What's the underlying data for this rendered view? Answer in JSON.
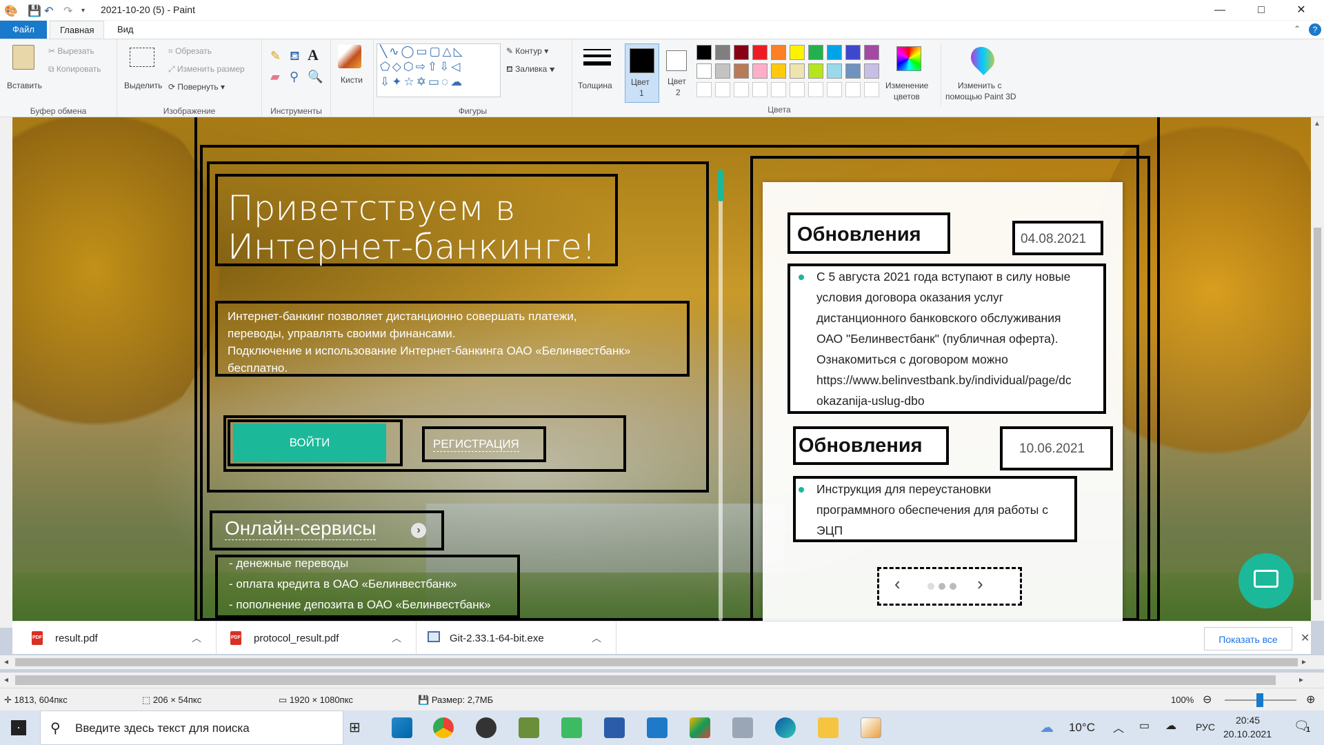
{
  "window": {
    "title": "2021-10-20 (5) - Paint",
    "minimize": "—",
    "maximize": "□",
    "close": "✕"
  },
  "menu": {
    "file": "Файл",
    "home": "Главная",
    "view": "Вид"
  },
  "ribbon": {
    "clipboard": {
      "paste": "Вставить",
      "cut": "Вырезать",
      "copy": "Копировать",
      "label": "Буфер обмена"
    },
    "image": {
      "select": "Выделить",
      "crop": "Обрезать",
      "resize": "Изменить размер",
      "rotate": "Повернуть",
      "label": "Изображение"
    },
    "tools": {
      "label": "Инструменты",
      "text_tool": "A"
    },
    "brushes": {
      "label": "Кисти"
    },
    "shapes": {
      "outline": "Контур",
      "fill": "Заливка",
      "label": "Фигуры"
    },
    "size": {
      "label": "Толщина"
    },
    "color1": {
      "label1": "Цвет",
      "label2": "1"
    },
    "color2": {
      "label1": "Цвет",
      "label2": "2"
    },
    "edit_colors": {
      "label1": "Изменение",
      "label2": "цветов"
    },
    "paint3d": {
      "label1": "Изменить с",
      "label2": "помощью Paint 3D"
    },
    "colors_label": "Цвета",
    "palette": [
      "#000000",
      "#7f7f7f",
      "#880015",
      "#ed1c24",
      "#ff7f27",
      "#fff200",
      "#22b14c",
      "#00a2e8",
      "#3f48cc",
      "#a349a4",
      "#ffffff",
      "#c3c3c3",
      "#b97a57",
      "#ffaec9",
      "#ffc90e",
      "#efe4b0",
      "#b5e61d",
      "#99d9ea",
      "#7092be",
      "#c8bfe7"
    ]
  },
  "page": {
    "hero_title": "Приветствуем в Интернет-банкинге!",
    "intro_line1": "Интернет-банкинг позволяет дистанционно совершать платежи,",
    "intro_line2": "переводы, управлять своими финансами.",
    "intro_line3": "Подключение и использование Интернет-банкинга ОАО «Белинвестбанк»",
    "intro_line4": "бесплатно.",
    "login_button": "ВОЙТИ",
    "register_button": "РЕГИСТРАЦИЯ",
    "online_services": "Онлайн-сервисы",
    "service1": "- денежные переводы",
    "service2": "- оплата кредита в ОАО «Белинвестбанк»",
    "service3": "- пополнение депозита в ОАО «Белинвестбанк»",
    "news1": {
      "heading": "Обновления",
      "date": "04.08.2021",
      "l1": "С 5 августа 2021 года вступают в силу новые",
      "l2": "условия договора оказания услуг",
      "l3": "дистанционного банковского обслуживания",
      "l4": "ОАО \"Белинвестбанк\" (публичная оферта).",
      "l5": "Ознакомиться с договором можно",
      "l6": "https://www.belinvestbank.by/individual/page/dc",
      "l7": "okazanija-uslug-dbo"
    },
    "news2": {
      "heading": "Обновления",
      "date": "10.06.2021",
      "l1": "Инструкция для переустановки",
      "l2": "программного обеспечения для работы с",
      "l3": "ЭЦП"
    },
    "carousel": {
      "prev": "‹",
      "next": "›"
    },
    "accent": "#1cb89a"
  },
  "downloads": [
    {
      "name": "result.pdf",
      "icon": "pdf-icon"
    },
    {
      "name": "protocol_result.pdf",
      "icon": "pdf-icon"
    },
    {
      "name": "Git-2.33.1-64-bit.exe",
      "icon": "exe-icon"
    }
  ],
  "show_all": "Показать все",
  "status": {
    "cursor": "1813, 604пкс",
    "selection": "206 × 54пкс",
    "canvas": "1920 × 1080пкс",
    "size": "Размер: 2,7МБ",
    "zoom": "100%"
  },
  "taskbar": {
    "search_placeholder": "Введите здесь текст для поиска",
    "weather": "10°C",
    "lang": "РУС",
    "time": "20:45",
    "date": "20.10.2021",
    "notif": "1"
  }
}
